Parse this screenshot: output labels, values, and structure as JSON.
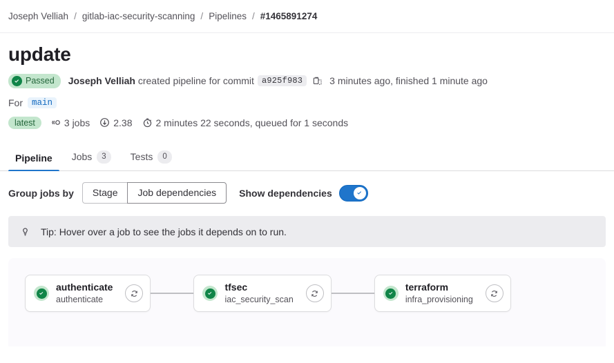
{
  "breadcrumb": {
    "items": [
      {
        "label": "Joseph Velliah",
        "current": false
      },
      {
        "label": "gitlab-iac-security-scanning",
        "current": false
      },
      {
        "label": "Pipelines",
        "current": false
      },
      {
        "label": "#1465891274",
        "current": true
      }
    ],
    "separator": "/"
  },
  "header": {
    "title": "update",
    "status_badge": {
      "label": "Passed",
      "icon": "check-circle-icon",
      "bg": "#c3e6cd",
      "fg": "#24663b"
    },
    "author": "Joseph Velliah",
    "action_text": "created pipeline for commit",
    "commit_sha": "a925f983",
    "copy_icon": "copy-icon",
    "timing": "3 minutes ago, finished 1 minute ago",
    "for_label": "For",
    "branch": "main",
    "meta": {
      "latest_pill": "latest",
      "jobs": {
        "icon": "pipeline-jobs-icon",
        "text": "3 jobs"
      },
      "score": {
        "icon": "ci-score-icon",
        "text": "2.38"
      },
      "duration": {
        "icon": "timer-icon",
        "text": "2 minutes 22 seconds, queued for 1 seconds"
      }
    }
  },
  "tabs": [
    {
      "label": "Pipeline",
      "count": null,
      "active": true
    },
    {
      "label": "Jobs",
      "count": "3",
      "active": false
    },
    {
      "label": "Tests",
      "count": "0",
      "active": false
    }
  ],
  "controls": {
    "group_jobs_by_label": "Group jobs by",
    "segments": [
      {
        "label": "Stage",
        "selected": false
      },
      {
        "label": "Job dependencies",
        "selected": true
      }
    ],
    "show_dependencies_label": "Show dependencies",
    "toggle_on": true,
    "toggle_color": "#1f75cb"
  },
  "tip": {
    "icon": "lightbulb-icon",
    "text": "Tip: Hover over a job to see the jobs it depends on to run."
  },
  "pipeline_graph": {
    "jobs": [
      {
        "name": "authenticate",
        "stage": "authenticate",
        "status": "success",
        "retry_icon": "retry-icon"
      },
      {
        "name": "tfsec",
        "stage": "iac_security_scan",
        "status": "success",
        "retry_icon": "retry-icon"
      },
      {
        "name": "terraform",
        "stage": "infra_provisioning",
        "status": "success",
        "retry_icon": "retry-icon"
      }
    ],
    "status_color": "#108548"
  }
}
